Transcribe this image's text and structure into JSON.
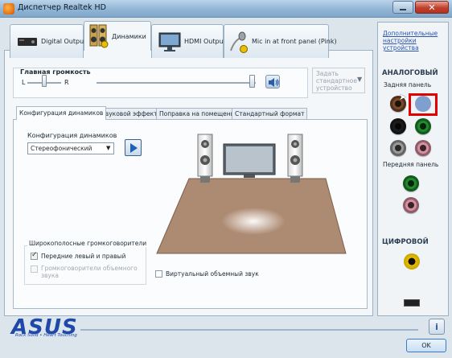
{
  "window": {
    "title": "Диспетчер Realtek HD",
    "close_glyph": "✕"
  },
  "device_tabs": [
    {
      "label": "Digital Output",
      "icon": "digital-output-icon",
      "active": false
    },
    {
      "label": "Динамики",
      "icon": "speakers-icon",
      "active": true
    },
    {
      "label": "HDMI Output",
      "icon": "monitor-icon",
      "active": false
    },
    {
      "label": "Mic in at front panel (Pink)",
      "icon": "microphone-icon",
      "active": false
    }
  ],
  "volume": {
    "label": "Главная громкость",
    "left_label": "L",
    "right_label": "R",
    "level": 0.98,
    "balance": 0.5
  },
  "default_device": {
    "line1": "Задать",
    "line2": "стандартное",
    "line3": "устройство"
  },
  "inner_tabs": [
    {
      "label": "Конфигурация динамиков",
      "active": true
    },
    {
      "label": "Звуковой эффект",
      "active": false
    },
    {
      "label": "Поправка на помещение",
      "active": false
    },
    {
      "label": "Стандартный формат",
      "active": false
    }
  ],
  "speaker_config": {
    "label": "Конфигурация динамиков",
    "selected": "Стереофонический"
  },
  "wideband": {
    "title": "Широкополосные громкоговорители",
    "front_label": "Передние левый и правый",
    "front_checked": true,
    "surround_label": "Громкоговорители объемного звука",
    "surround_checked": false
  },
  "virtual_surround": {
    "label": "Виртуальный объемный звук",
    "checked": false
  },
  "right_panel": {
    "advanced_link": "Дополнительные настройки устройства",
    "analog_title": "АНАЛОГОВЫЙ",
    "rear_label": "Задняя панель",
    "front_label": "Передняя панель",
    "digital_title": "ЦИФРОВОЙ",
    "jack_colors": {
      "brown": "#7a4a2a",
      "blue": "#7f9fcf",
      "black": "#1c1c1c",
      "green": "#1f8a2e",
      "gray": "#9a9a9a",
      "pink": "#d98fa0",
      "highlight": "#e00000"
    }
  },
  "footer": {
    "logo": "ASUS",
    "tagline": "Rock Solid • Heart Touching",
    "info": "i",
    "ok": "OK"
  }
}
